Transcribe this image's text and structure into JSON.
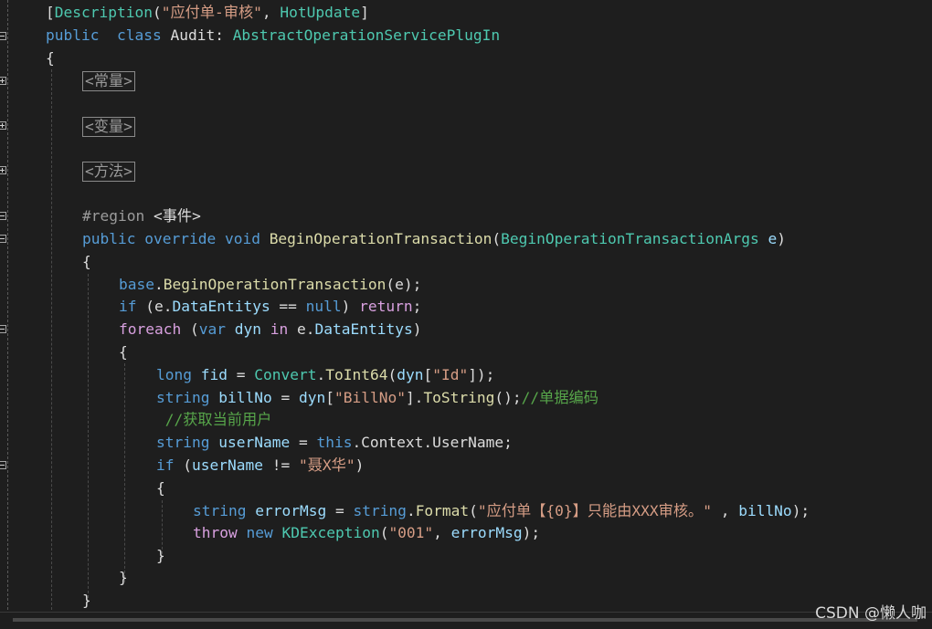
{
  "code": {
    "lines": [
      [
        [
          "[",
          "plain"
        ],
        [
          "Description",
          "type"
        ],
        [
          "(",
          "plain"
        ],
        [
          "\"应付单-审核\"",
          "str"
        ],
        [
          ", ",
          "plain"
        ],
        [
          "HotUpdate",
          "type"
        ],
        [
          "]",
          "plain"
        ]
      ],
      [
        [
          "public",
          "kw"
        ],
        [
          "  ",
          "plain"
        ],
        [
          "class",
          "kw"
        ],
        [
          " Audit: ",
          "plain"
        ],
        [
          "AbstractOperationServicePlugIn",
          "type"
        ]
      ],
      [
        [
          "{",
          "plain"
        ]
      ],
      [
        [
          "#region ",
          "preproc"
        ],
        [
          "<事件>",
          "region"
        ]
      ],
      [
        [
          "public",
          "kw"
        ],
        [
          " ",
          "plain"
        ],
        [
          "override",
          "kw"
        ],
        [
          " ",
          "plain"
        ],
        [
          "void",
          "kw"
        ],
        [
          " ",
          "plain"
        ],
        [
          "BeginOperationTransaction",
          "method"
        ],
        [
          "(",
          "plain"
        ],
        [
          "BeginOperationTransactionArgs",
          "type"
        ],
        [
          " ",
          "plain"
        ],
        [
          "e",
          "var"
        ],
        [
          ")",
          "plain"
        ]
      ],
      [
        [
          "{",
          "plain"
        ]
      ],
      [
        [
          "base",
          "kw"
        ],
        [
          ".",
          "plain"
        ],
        [
          "BeginOperationTransaction",
          "method"
        ],
        [
          "(e);",
          "plain"
        ]
      ],
      [
        [
          "if",
          "kw"
        ],
        [
          " (e.",
          "plain"
        ],
        [
          "DataEntitys",
          "var"
        ],
        [
          " == ",
          "plain"
        ],
        [
          "null",
          "kw"
        ],
        [
          ") ",
          "plain"
        ],
        [
          "return",
          "control"
        ],
        [
          ";",
          "plain"
        ]
      ],
      [
        [
          "foreach",
          "control"
        ],
        [
          " (",
          "plain"
        ],
        [
          "var",
          "kw"
        ],
        [
          " ",
          "plain"
        ],
        [
          "dyn",
          "var"
        ],
        [
          " ",
          "plain"
        ],
        [
          "in",
          "control"
        ],
        [
          " e.",
          "plain"
        ],
        [
          "DataEntitys",
          "var"
        ],
        [
          ")",
          "plain"
        ]
      ],
      [
        [
          "{",
          "plain"
        ]
      ],
      [
        [
          "long",
          "kw"
        ],
        [
          " ",
          "plain"
        ],
        [
          "fid",
          "var"
        ],
        [
          " = ",
          "plain"
        ],
        [
          "Convert",
          "type"
        ],
        [
          ".",
          "plain"
        ],
        [
          "ToInt64",
          "method"
        ],
        [
          "(",
          "plain"
        ],
        [
          "dyn",
          "var"
        ],
        [
          "[",
          "plain"
        ],
        [
          "\"Id\"",
          "str"
        ],
        [
          "]);",
          "plain"
        ]
      ],
      [
        [
          "string",
          "kw"
        ],
        [
          " ",
          "plain"
        ],
        [
          "billNo",
          "var"
        ],
        [
          " = ",
          "plain"
        ],
        [
          "dyn",
          "var"
        ],
        [
          "[",
          "plain"
        ],
        [
          "\"BillNo\"",
          "str"
        ],
        [
          "].",
          "plain"
        ],
        [
          "ToString",
          "method"
        ],
        [
          "();",
          "plain"
        ],
        [
          "//单据编码",
          "comment"
        ]
      ],
      [
        [
          " //获取当前用户",
          "comment"
        ]
      ],
      [
        [
          "string",
          "kw"
        ],
        [
          " ",
          "plain"
        ],
        [
          "userName",
          "var"
        ],
        [
          " = ",
          "plain"
        ],
        [
          "this",
          "kw"
        ],
        [
          ".Context.UserName;",
          "plain"
        ]
      ],
      [
        [
          "if",
          "kw"
        ],
        [
          " (",
          "plain"
        ],
        [
          "userName",
          "var"
        ],
        [
          " != ",
          "plain"
        ],
        [
          "\"聂X华\"",
          "str"
        ],
        [
          ")",
          "plain"
        ]
      ],
      [
        [
          "{",
          "plain"
        ]
      ],
      [
        [
          "string",
          "kw"
        ],
        [
          " ",
          "plain"
        ],
        [
          "errorMsg",
          "var"
        ],
        [
          " = ",
          "plain"
        ],
        [
          "string",
          "kw"
        ],
        [
          ".",
          "plain"
        ],
        [
          "Format",
          "method"
        ],
        [
          "(",
          "plain"
        ],
        [
          "\"应付单【{0}】只能由XXX审核。\"",
          "str"
        ],
        [
          " , ",
          "plain"
        ],
        [
          "billNo",
          "var"
        ],
        [
          ");",
          "plain"
        ]
      ],
      [
        [
          "throw",
          "control"
        ],
        [
          " ",
          "plain"
        ],
        [
          "new",
          "kw"
        ],
        [
          " ",
          "plain"
        ],
        [
          "KDException",
          "type"
        ],
        [
          "(",
          "plain"
        ],
        [
          "\"001\"",
          "str"
        ],
        [
          ", ",
          "plain"
        ],
        [
          "errorMsg",
          "var"
        ],
        [
          ");",
          "plain"
        ]
      ],
      [
        [
          "}",
          "plain"
        ]
      ],
      [
        [
          "}",
          "plain"
        ]
      ],
      [
        [
          "}",
          "plain"
        ]
      ]
    ],
    "collapsed_regions": [
      "<常量>",
      "<变量>",
      "<方法>"
    ]
  },
  "watermark": "CSDN @懒人咖",
  "colors": {
    "background": "#1e1e1e",
    "keyword": "#569cd6",
    "type": "#4ec9b0",
    "method": "#dcdcaa",
    "string": "#d69d85",
    "comment": "#57a64a",
    "variable": "#9cdcfe",
    "control": "#d8a0df"
  }
}
